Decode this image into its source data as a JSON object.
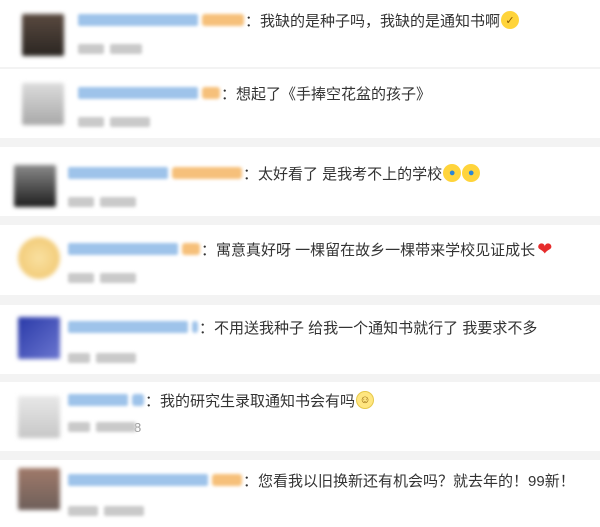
{
  "comments": [
    {
      "text": "我缺的是种子吗，我缺的是通知书啊",
      "emoji": "😂",
      "meta_num": ""
    },
    {
      "text": "想起了《手捧空花盆的孩子》",
      "emoji": "",
      "meta_num": ""
    },
    {
      "text": "太好看了 是我考不上的学校",
      "emoji": "😭😭",
      "meta_num": ""
    },
    {
      "text": "寓意真好呀 一棵留在故乡一棵带来学校见证成长",
      "emoji": "❤",
      "meta_num": ""
    },
    {
      "text": "不用送我种子 给我一个通知书就行了  我要求不多",
      "emoji": "",
      "meta_num": ""
    },
    {
      "text": "我的研究生录取通知书会有吗",
      "emoji": "😉",
      "meta_num": "8"
    },
    {
      "text": "您看我以旧换新还有机会吗？就去年的！99新！",
      "emoji": "",
      "meta_num": ""
    }
  ],
  "separator": "：",
  "colors": {
    "background": "#f3f3f3",
    "card": "#ffffff",
    "username_blur": "#9ec3ea",
    "text": "#333333",
    "meta": "#999999"
  }
}
